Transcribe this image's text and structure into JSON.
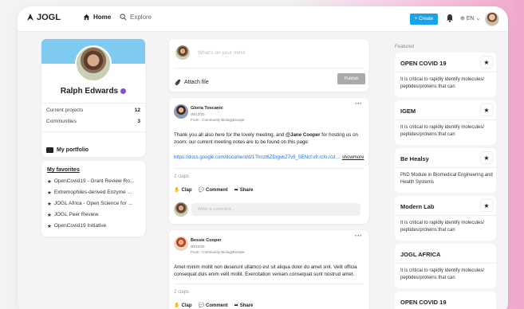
{
  "header": {
    "logo": "JOGL",
    "home": "Home",
    "explore": "Explore",
    "create": "+ Create",
    "lang": "EN"
  },
  "profile": {
    "name": "Ralph Edwards",
    "projects_label": "Current projects",
    "projects_count": "12",
    "communities_label": "Communities",
    "communities_count": "3",
    "portfolio": "My portfolio"
  },
  "favorites": {
    "title": "My favorites",
    "items": [
      "OpenCovid19 - Grant Review Ro...",
      "Extremophiles-derived Enzyme ...",
      "JOGL Africa - Open Science for ...",
      "JOGL Peer Review.",
      "OpenCovid19 Initiative"
    ]
  },
  "composer": {
    "placeholder": "What's on your mind",
    "attach": "Attach file",
    "publish": "Publish"
  },
  "posts": [
    {
      "author": "Gloria Toscanic",
      "date": "00/12/20",
      "from": "From : Community BiologyEurope",
      "text_before": "Thank you all also here for the lovely meeting, and ",
      "mention": "@Jane Cooper",
      "text_after": " for hosting us on zoom: our current meeting notes are to be found on this page:",
      "link": "https://docs.google.com/document/d/1Thnzt6ZDrgvkZ7v9_SENcf.vfr.rcfo.rcd ...",
      "showmore": "showmore",
      "claps": "2 claps",
      "clap": "Clap",
      "comment": "Comment",
      "share": "Share",
      "comment_placeholder": "Write a comment..."
    },
    {
      "author": "Bessie Cooper",
      "date": "00/12/20",
      "from": "From : Community BiologyEurope",
      "text": "Amet minim mollit non deserunt ullamco est sit aliqua dolor do amet sint. Velit officia consequat duis enim velit mollit. Exercitation veniam consequat sunt nostrud amet.",
      "claps": "2 claps",
      "clap": "Clap",
      "comment": "Comment",
      "share": "Share"
    }
  ],
  "featured": {
    "label": "Featured",
    "items": [
      {
        "title": "OPEN COVID 19",
        "desc": "It is critical to rapidly identify molecules/ peptides/proteins that can"
      },
      {
        "title": "IGEM",
        "desc": "It is critical to rapidly identify molecules/ peptides/proteins that can"
      },
      {
        "title": "Be Healsy",
        "desc": "PhD Module in Biomedical Engineering and Health Systems"
      },
      {
        "title": "Modern Lab",
        "desc": "It is critical to rapidly identify molecules/ peptides/proteins that can"
      },
      {
        "title": "JOGL AFRICA",
        "desc": "It is critical to rapidly identify molecules/ peptides/proteins that can"
      },
      {
        "title": "OPEN COVID 19",
        "desc": ""
      }
    ]
  },
  "colors": {
    "accent": "#18a3e8",
    "banner": "#7fcaf0",
    "verified": "#8c4ccc"
  }
}
